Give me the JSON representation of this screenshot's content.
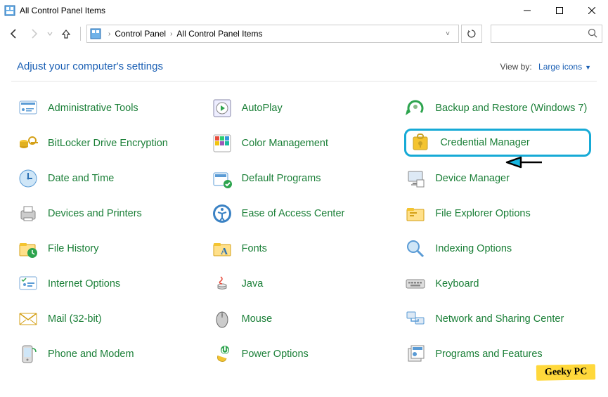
{
  "window": {
    "title": "All Control Panel Items"
  },
  "breadcrumb": {
    "items": [
      "Control Panel",
      "All Control Panel Items"
    ]
  },
  "header": {
    "title": "Adjust your computer's settings",
    "view_by_label": "View by:",
    "view_by_value": "Large icons"
  },
  "items": [
    {
      "label": "Administrative Tools",
      "icon": "admin-tools"
    },
    {
      "label": "AutoPlay",
      "icon": "autoplay"
    },
    {
      "label": "Backup and Restore (Windows 7)",
      "icon": "backup"
    },
    {
      "label": "BitLocker Drive Encryption",
      "icon": "bitlocker"
    },
    {
      "label": "Color Management",
      "icon": "color"
    },
    {
      "label": "Credential Manager",
      "icon": "credential",
      "highlighted": true
    },
    {
      "label": "Date and Time",
      "icon": "datetime"
    },
    {
      "label": "Default Programs",
      "icon": "default-programs"
    },
    {
      "label": "Device Manager",
      "icon": "device-manager"
    },
    {
      "label": "Devices and Printers",
      "icon": "devices-printers"
    },
    {
      "label": "Ease of Access Center",
      "icon": "ease-access"
    },
    {
      "label": "File Explorer Options",
      "icon": "file-explorer"
    },
    {
      "label": "File History",
      "icon": "file-history"
    },
    {
      "label": "Fonts",
      "icon": "fonts"
    },
    {
      "label": "Indexing Options",
      "icon": "indexing"
    },
    {
      "label": "Internet Options",
      "icon": "internet"
    },
    {
      "label": "Java",
      "icon": "java"
    },
    {
      "label": "Keyboard",
      "icon": "keyboard"
    },
    {
      "label": "Mail (32-bit)",
      "icon": "mail"
    },
    {
      "label": "Mouse",
      "icon": "mouse"
    },
    {
      "label": "Network and Sharing Center",
      "icon": "network"
    },
    {
      "label": "Phone and Modem",
      "icon": "phone"
    },
    {
      "label": "Power Options",
      "icon": "power"
    },
    {
      "label": "Programs and Features",
      "icon": "programs"
    }
  ],
  "watermark": "Geeky PC"
}
